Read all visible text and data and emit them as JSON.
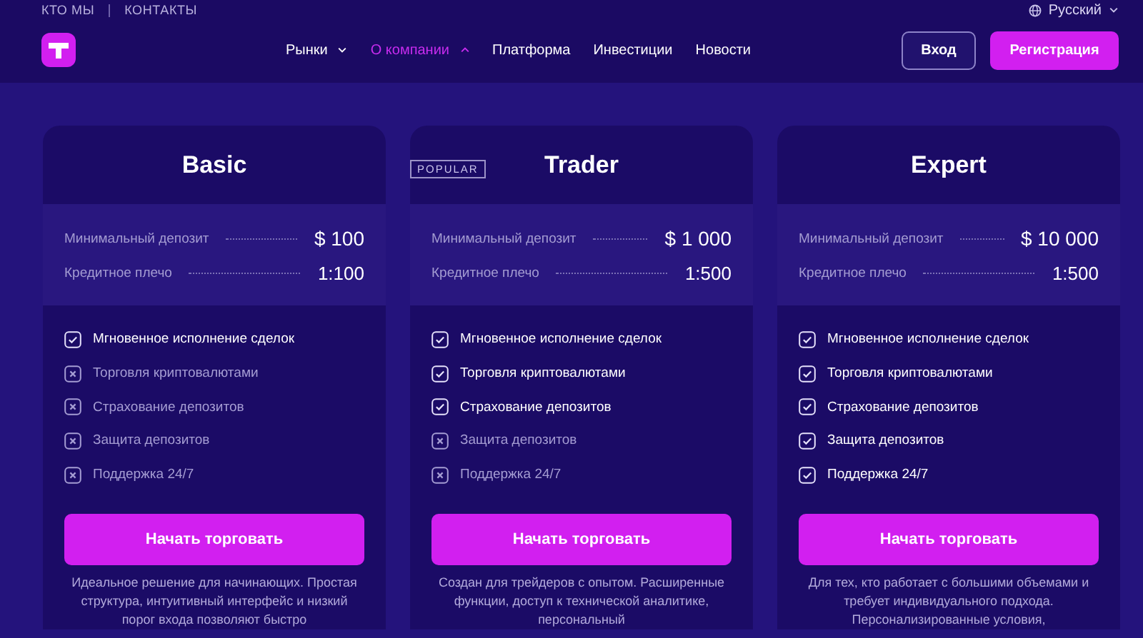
{
  "top_links": [
    "КТО МЫ",
    "КОНТАКТЫ"
  ],
  "language": "Русский",
  "nav": [
    {
      "label": "Рынки",
      "kind": "menu",
      "selected": false,
      "expanded": false
    },
    {
      "label": "О компании",
      "kind": "menu",
      "selected": true,
      "expanded": true
    },
    {
      "label": "Платформа",
      "kind": "link",
      "selected": false
    },
    {
      "label": "Инвестиции",
      "kind": "link",
      "selected": false
    },
    {
      "label": "Новости",
      "kind": "link",
      "selected": false
    }
  ],
  "login": "Вход",
  "register": "Регистрация",
  "plans": [
    {
      "name": "Basic",
      "stats": [
        {
          "label": "Минимальный депозит",
          "value": "$ 100"
        },
        {
          "label": "Кредитное плечо",
          "value": "1:100"
        }
      ],
      "features": [
        {
          "label": "Мгновенное исполнение сделок",
          "included": true
        },
        {
          "label": "Торговля криптовалютами",
          "included": false
        },
        {
          "label": "Страхование депозитов",
          "included": false
        },
        {
          "label": "Защита депозитов",
          "included": false
        },
        {
          "label": "Поддержка 24/7",
          "included": false
        }
      ],
      "button": "Начать торговать",
      "description": "Идеальное решение для начинающих. Простая структура, интуитивный интерфейс и низкий порог входа позволяют быстро"
    },
    {
      "name": "Trader",
      "badge": "POPULAR",
      "stats": [
        {
          "label": "Минимальный депозит",
          "value": "$ 1 000"
        },
        {
          "label": "Кредитное плечо",
          "value": "1:500"
        }
      ],
      "features": [
        {
          "label": "Мгновенное исполнение сделок",
          "included": true
        },
        {
          "label": "Торговля криптовалютами",
          "included": true
        },
        {
          "label": "Страхование депозитов",
          "included": true
        },
        {
          "label": "Защита депозитов",
          "included": false
        },
        {
          "label": "Поддержка 24/7",
          "included": false
        }
      ],
      "button": "Начать торговать",
      "description": "Создан для трейдеров с опытом. Расширенные функции, доступ к технической аналитике, персональный"
    },
    {
      "name": "Expert",
      "stats": [
        {
          "label": "Минимальный депозит",
          "value": "$ 10 000"
        },
        {
          "label": "Кредитное плечо",
          "value": "1:500"
        }
      ],
      "features": [
        {
          "label": "Мгновенное исполнение сделок",
          "included": true
        },
        {
          "label": "Торговля криптовалютами",
          "included": true
        },
        {
          "label": "Страхование депозитов",
          "included": true
        },
        {
          "label": "Защита депозитов",
          "included": true
        },
        {
          "label": "Поддержка 24/7",
          "included": true
        }
      ],
      "button": "Начать торговать",
      "description": "Для тех, кто работает с большими объемами и требует индивидуального подхода. Персонализированные условия,"
    }
  ]
}
